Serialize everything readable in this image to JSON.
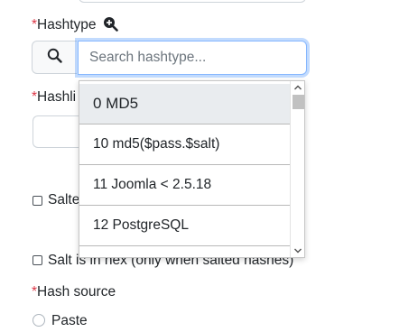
{
  "required_marker": "*",
  "hashtype": {
    "label": "Hashtype",
    "search_placeholder": "Search hashtype...",
    "search_value": ""
  },
  "hashlist": {
    "label_visible": "Hashli"
  },
  "salted": {
    "label_visible": "Salte"
  },
  "salt_hex": {
    "label": "Salt is in hex (only when salted hashes)"
  },
  "hash_source": {
    "label": "Hash source",
    "options": [
      "Paste"
    ]
  },
  "dropdown": {
    "options": [
      {
        "label": "0 MD5",
        "selected": true
      },
      {
        "label": "10 md5($pass.$salt)",
        "selected": false
      },
      {
        "label": "11 Joomla < 2.5.18",
        "selected": false
      },
      {
        "label": "12 PostgreSQL",
        "selected": false
      },
      {
        "label": "",
        "selected": false
      }
    ]
  },
  "icons": {
    "zoom": "zoom-in-icon",
    "search": "search-icon"
  }
}
